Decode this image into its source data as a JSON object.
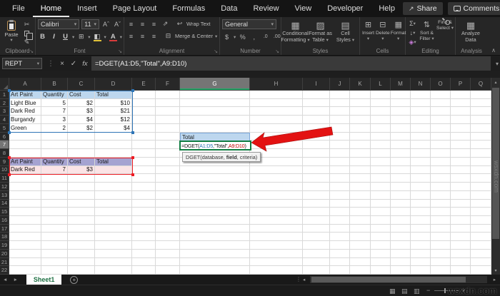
{
  "titlebar": {
    "tabs": [
      "File",
      "Home",
      "Insert",
      "Page Layout",
      "Formulas",
      "Data",
      "Review",
      "View",
      "Developer",
      "Help"
    ],
    "active_tab": "Home",
    "share_label": "Share",
    "comments_label": "Comments"
  },
  "ribbon": {
    "clipboard": {
      "label": "Clipboard",
      "paste_label": "Paste"
    },
    "font": {
      "label": "Font",
      "font_name": "Calibri",
      "font_size": "11",
      "bold": "B",
      "italic": "I",
      "underline": "U",
      "grow": "Aˆ",
      "shrink": "Aˇ",
      "color_letter": "A"
    },
    "alignment": {
      "label": "Alignment",
      "wrap_text": "Wrap Text",
      "merge_center": "Merge & Center"
    },
    "number": {
      "label": "Number",
      "format_value": "General",
      "currency": "$",
      "percent": "%",
      "comma": ",",
      "inc_dec": ".0",
      "dec_dec": ".00"
    },
    "styles": {
      "label": "Styles",
      "items": [
        [
          "Conditional",
          "Formatting"
        ],
        [
          "Format as",
          "Table"
        ],
        [
          "Cell",
          "Styles"
        ]
      ]
    },
    "cells": {
      "label": "Cells",
      "items": [
        [
          "Insert",
          ""
        ],
        [
          "Delete",
          ""
        ],
        [
          "Format",
          ""
        ]
      ]
    },
    "editing": {
      "label": "Editing",
      "autosum": "Σ",
      "sort_filter": [
        "Sort &",
        "Filter"
      ],
      "find_select": [
        "Find &",
        "Select"
      ]
    },
    "analysis": {
      "label": "Analysis",
      "analyze": [
        "Analyze",
        "Data"
      ]
    }
  },
  "formula_bar": {
    "name_box": "REPT",
    "formula": "=DGET(A1:D5,\"Total\",A9:D10)"
  },
  "grid": {
    "columns": [
      [
        "A",
        45
      ],
      [
        "B",
        37
      ],
      [
        "C",
        38
      ],
      [
        "D",
        52
      ],
      [
        "E",
        33
      ],
      [
        "F",
        34
      ],
      [
        "G",
        98
      ],
      [
        "H",
        74
      ],
      [
        "I",
        38
      ],
      [
        "J",
        28
      ],
      [
        "K",
        29
      ],
      [
        "L",
        28
      ],
      [
        "M",
        28
      ],
      [
        "N",
        28
      ],
      [
        "O",
        28
      ],
      [
        "P",
        28
      ],
      [
        "Q",
        28
      ]
    ],
    "selected_column": "G",
    "selected_row": 7,
    "row_count": 22,
    "cells": {
      "A1": "Art Paint",
      "B1": "Quantity",
      "C1": "Cost",
      "D1": "Total",
      "A2": "Light Blue",
      "B2": "5",
      "C2": "$2",
      "D2": "$10",
      "A3": "Dark Red",
      "B3": "7",
      "C3": "$3",
      "D3": "$21",
      "A4": "Burgandy",
      "B4": "3",
      "C4": "$4",
      "D4": "$12",
      "A5": "Green",
      "B5": "2",
      "C5": "$2",
      "D5": "$4",
      "A9": "Art Paint",
      "B9": "Quantity",
      "C9": "Cost",
      "D9": "Total",
      "A10": "Dark Red",
      "B10": "7",
      "C10": "$3"
    },
    "numeric_cells": [
      "B2",
      "C2",
      "D2",
      "B3",
      "C3",
      "D3",
      "B4",
      "C4",
      "D4",
      "B5",
      "C5",
      "D5",
      "B10",
      "C10"
    ],
    "styled_rows": {
      "1": "hdr-blue",
      "9": "hdr-purple",
      "10": "row-pink"
    },
    "styled_cols": "ABCD"
  },
  "overlays": {
    "result_cell": {
      "ref": "G6",
      "text": "Total"
    },
    "edit_cell": {
      "ref": "G7",
      "parts": [
        {
          "t": "=DGET(",
          "c": "#1a1a1a"
        },
        {
          "t": "A1:D5",
          "c": "#2e75b6"
        },
        {
          "t": ",\"Total\",",
          "c": "#1a1a1a"
        },
        {
          "t": "A9:D10",
          "c": "#c00000"
        },
        {
          "t": ")",
          "c": "#1a1a1a"
        }
      ]
    },
    "tooltip": {
      "parts": [
        {
          "t": "DGET("
        },
        {
          "t": "database"
        },
        {
          "t": ", "
        },
        {
          "t": "field",
          "b": true
        },
        {
          "t": ", "
        },
        {
          "t": "criteria"
        },
        {
          "t": ")"
        }
      ]
    }
  },
  "sheet_tabs": {
    "active": "Sheet1"
  },
  "status_bar": {},
  "watermark": {
    "bottom": "wsxdn.com",
    "side": "wsxdn.com"
  },
  "colors": {
    "selection_green": "#107c41",
    "ref_blue": "#2e75b6",
    "ref_red": "#c00000",
    "table_header_blue": "#bdd7ee",
    "criteria_header_purple": "#a5a3d1",
    "criteria_row_pink": "#fbe4e6",
    "arrow_red": "#e31212"
  },
  "icons": {
    "dropdown": "▾",
    "launcher": "↘",
    "scissors": "✂",
    "format_painter": "✎",
    "borders": "⊞",
    "fill": "◧",
    "align": "≡",
    "orientation": "⇗",
    "wrap": "↩",
    "merge": "⊟",
    "autosum": "Σ",
    "fill_down": "↓",
    "clear": "◈",
    "sort": "⇅",
    "cond_format": "▦",
    "format_table": "▨",
    "cell_styles": "▤",
    "insert": "⊞",
    "delete": "⊟",
    "format": "▦",
    "analyze": "▦",
    "share": "↗",
    "check": "✓",
    "close": "×",
    "fx": "fx",
    "menu_dots": "⋮",
    "name_dd": "▾",
    "nav_left": "◄",
    "nav_right": "►",
    "add_sheet": "+",
    "vup": "▴",
    "vdown": "▾",
    "hleft": "◂",
    "hright": "▸",
    "view_normal": "▦",
    "view_layout": "▤",
    "view_break": "▥",
    "zoom_minus": "−",
    "zoom_plus": "+",
    "collapse": "∧"
  }
}
